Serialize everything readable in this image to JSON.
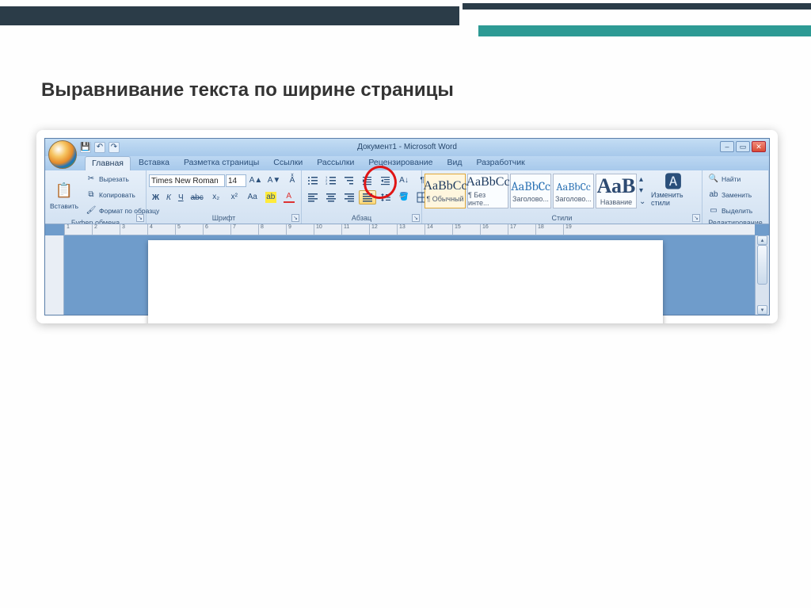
{
  "slide": {
    "title": "Выравнивание текста по ширине страницы"
  },
  "window": {
    "title": "Документ1 - Microsoft Word"
  },
  "tabs": {
    "home": "Главная",
    "insert": "Вставка",
    "pagelayout": "Разметка страницы",
    "references": "Ссылки",
    "mailings": "Рассылки",
    "review": "Рецензирование",
    "view": "Вид",
    "developer": "Разработчик"
  },
  "clipboard": {
    "paste": "Вставить",
    "cut": "Вырезать",
    "copy": "Копировать",
    "painter": "Формат по образцу",
    "group_label": "Буфер обмена"
  },
  "font": {
    "name": "Times New Roman",
    "size": "14",
    "bold": "Ж",
    "italic": "К",
    "underline": "Ч",
    "strike": "abc",
    "group_label": "Шрифт"
  },
  "paragraph": {
    "group_label": "Абзац"
  },
  "styles": {
    "normal": "¶ Обычный",
    "nospace": "¶ Без инте...",
    "h1": "Заголово...",
    "h2": "Заголово...",
    "title_style": "Название",
    "change": "Изменить стили",
    "group_label": "Стили",
    "preview_serif": "AaBbCc",
    "preview_sans": "AaBbCc",
    "preview_cambria": "AaBbCc",
    "preview_big": "АаВ"
  },
  "editing": {
    "find": "Найти",
    "replace": "Заменить",
    "select": "Выделить",
    "group_label": "Редактирование"
  }
}
